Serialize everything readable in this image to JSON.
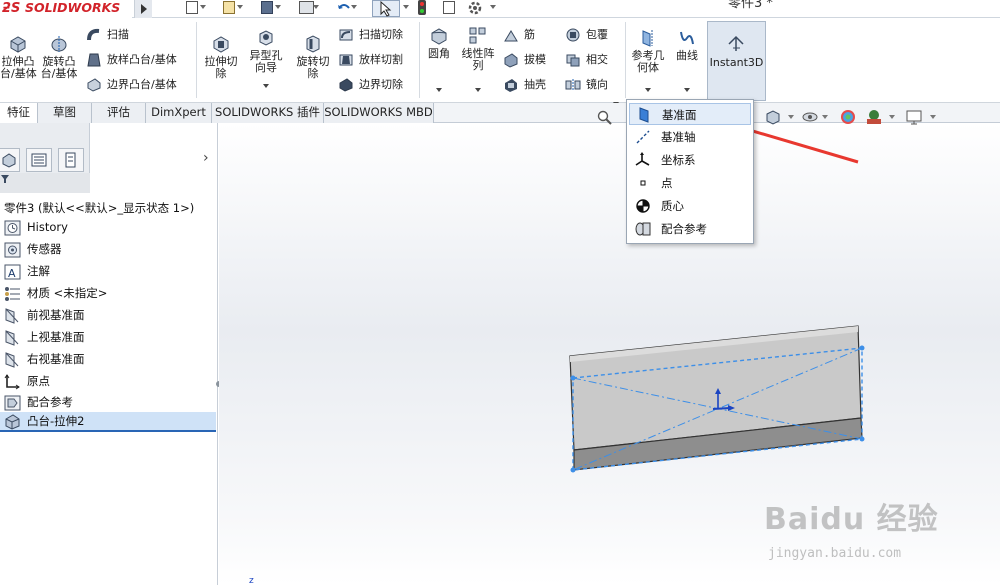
{
  "app": {
    "brand": "SOLIDWORKS",
    "document_title": "零件3 *"
  },
  "ribbon": {
    "extruded_boss_label": "拉伸凸\n台/基体",
    "revolved_boss_label": "旋转凸\n台/基体",
    "sweep_label": "扫描",
    "loft_boss_label": "放样凸台/基体",
    "boundary_boss_label": "边界凸台/基体",
    "extruded_cut_label": "拉伸切\n除",
    "hole_wizard_label": "异型孔\n向导",
    "revolved_cut_label": "旋转切\n除",
    "swept_cut_label": "扫描切除",
    "lofted_cut_label": "放样切割",
    "boundary_cut_label": "边界切除",
    "fillet_label": "圆角",
    "linear_pattern_label": "线性阵\n列",
    "rib_label": "筋",
    "draft_label": "拔模",
    "shell_label": "抽壳",
    "wrap_label": "包覆",
    "intersect_label": "相交",
    "mirror_label": "镜向",
    "ref_geometry_label": "参考几\n何体",
    "curves_label": "曲线",
    "instant3d_label": "Instant3D"
  },
  "tabs": [
    {
      "label": "特征"
    },
    {
      "label": "草图"
    },
    {
      "label": "评估"
    },
    {
      "label": "DimXpert"
    },
    {
      "label": "SOLIDWORKS 插件"
    },
    {
      "label": "SOLIDWORKS MBD"
    }
  ],
  "tree": {
    "root_label": "零件3  (默认<<默认>_显示状态 1>)",
    "items": [
      {
        "label": "History",
        "icon": "history-icon"
      },
      {
        "label": "传感器",
        "icon": "sensor-icon"
      },
      {
        "label": "注解",
        "icon": "annotation-icon"
      },
      {
        "label": "材质 <未指定>",
        "icon": "material-icon"
      },
      {
        "label": "前视基准面",
        "icon": "plane-icon"
      },
      {
        "label": "上视基准面",
        "icon": "plane-icon"
      },
      {
        "label": "右视基准面",
        "icon": "plane-icon"
      },
      {
        "label": "原点",
        "icon": "origin-icon"
      },
      {
        "label": "配合参考",
        "icon": "mate-reference-icon"
      },
      {
        "label": "凸台-拉伸2",
        "icon": "boss-extrude-icon"
      }
    ]
  },
  "ref_geometry_menu": {
    "items": [
      {
        "label": "基准面",
        "icon": "plane-icon"
      },
      {
        "label": "基准轴",
        "icon": "axis-icon"
      },
      {
        "label": "坐标系",
        "icon": "coordinate-system-icon"
      },
      {
        "label": "点",
        "icon": "point-icon"
      },
      {
        "label": "质心",
        "icon": "center-of-mass-icon"
      },
      {
        "label": "配合参考",
        "icon": "mate-reference-icon"
      }
    ],
    "highlighted": "基准面"
  },
  "watermark": {
    "brand": "Baidu 经验",
    "url": "jingyan.baidu.com"
  },
  "colors": {
    "annotation_arrow": "#e8382f",
    "selection_blue": "#2965b5",
    "brand_red": "#d2232a"
  }
}
